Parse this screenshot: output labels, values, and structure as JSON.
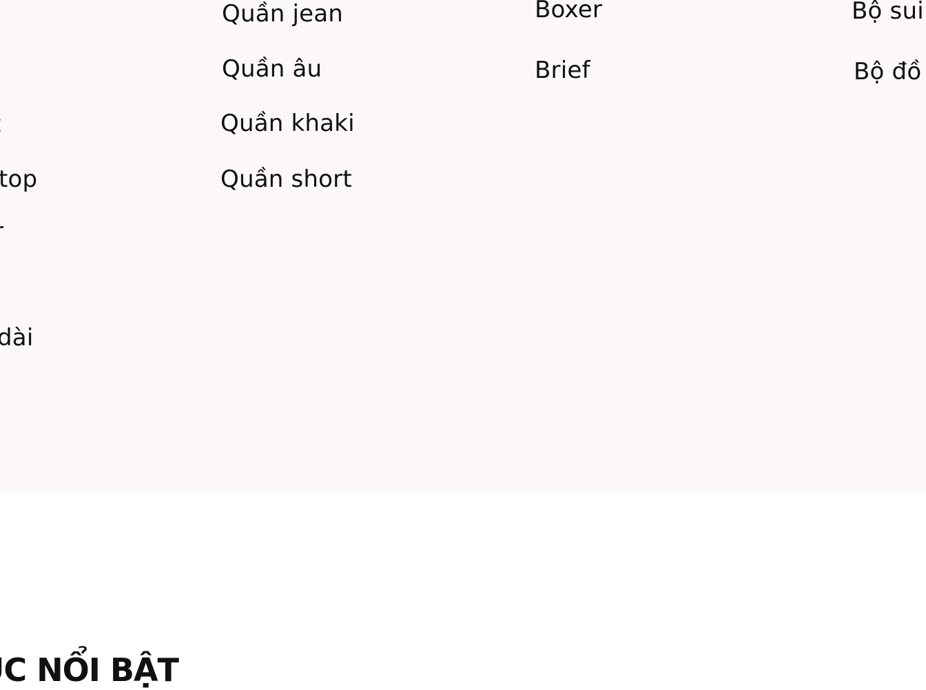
{
  "menu": {
    "column_1": {
      "items": [
        "t",
        "top",
        "r",
        "dài"
      ]
    },
    "column_2": {
      "items": [
        "Quần jean",
        "Quần âu",
        "Quần khaki",
        "Quần short"
      ]
    },
    "column_3": {
      "items": [
        "Boxer",
        "Brief"
      ]
    },
    "column_4": {
      "items": [
        "Bộ sui",
        "Bộ đồ"
      ]
    }
  },
  "section": {
    "heading": "ỤC NỔI BẬT"
  }
}
